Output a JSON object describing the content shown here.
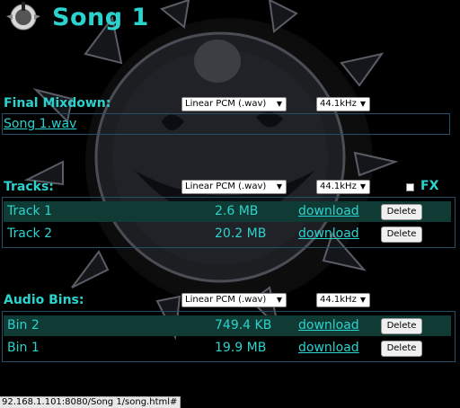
{
  "header": {
    "title": "Song 1",
    "logo_icon": "knob-icon"
  },
  "format_options": {
    "format": "Linear PCM (.wav)",
    "rate": "44.1kHz"
  },
  "mixdown": {
    "label": "Final Mixdown:",
    "link": "Song 1.wav"
  },
  "tracks": {
    "label": "Tracks:",
    "fx_label": "FX",
    "rows": [
      {
        "name": "Track 1",
        "size": "2.6 MB",
        "link": "download",
        "delete": "Delete"
      },
      {
        "name": "Track 2",
        "size": "20.2 MB",
        "link": "download",
        "delete": "Delete"
      }
    ]
  },
  "audio_bins": {
    "label": "Audio Bins:",
    "rows": [
      {
        "name": "Bin 2",
        "size": "749.4 KB",
        "link": "download",
        "delete": "Delete"
      },
      {
        "name": "Bin 1",
        "size": "19.9 MB",
        "link": "download",
        "delete": "Delete"
      }
    ]
  },
  "status_bar": {
    "url": "92.168.1.101:8080/Song 1/song.html#"
  },
  "colors": {
    "accent": "#2bd3cf",
    "row_highlight": "#0f3b34",
    "border": "#244f66"
  }
}
